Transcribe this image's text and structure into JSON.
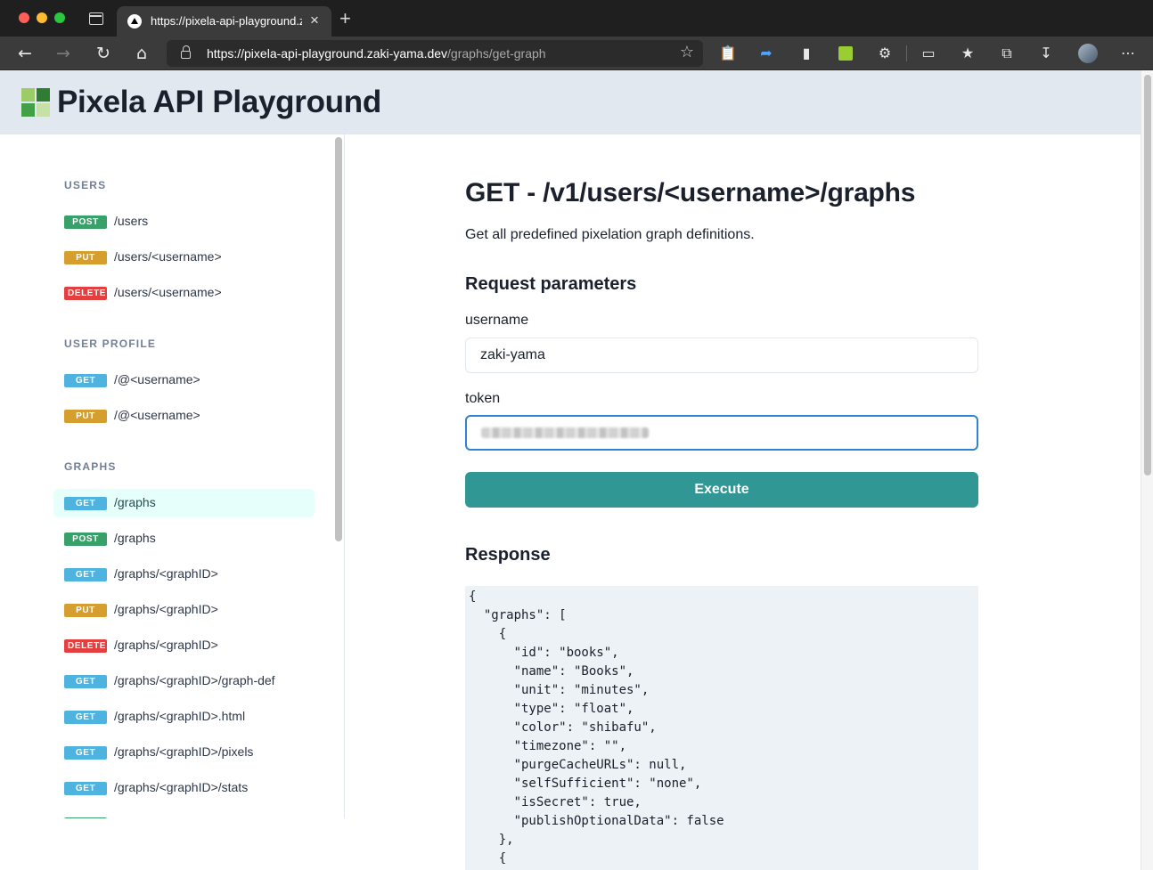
{
  "browser": {
    "tab_title": "https://pixela-api-playground.z",
    "tab_close": "×",
    "new_tab": "+",
    "url_host": "https://pixela-api-playground.zaki-yama.dev",
    "url_path": "/graphs/get-graph"
  },
  "icons": {
    "back": "back-arrow-icon",
    "forward": "forward-arrow-icon",
    "reload": "reload-icon",
    "home": "home-icon",
    "lock": "lock-icon",
    "favorite_add": "favorite-add-icon",
    "extensions": [
      "clipboard-icon",
      "share-icon",
      "bookmark-icon",
      "green-square-icon",
      "puzzle-icon"
    ],
    "cast": "cast-icon",
    "favorites": "favorites-icon",
    "collections": "collections-icon",
    "download": "download-icon",
    "more": "more-icon"
  },
  "header": {
    "title": "Pixela API Playground",
    "logo_colors": [
      "#9ccc65",
      "#2e7d32",
      "#43a047",
      "#c5e1a5"
    ]
  },
  "sidebar": {
    "groups": [
      {
        "title": "USERS",
        "items": [
          {
            "method": "POST",
            "path": "/users"
          },
          {
            "method": "PUT",
            "path": "/users/<username>"
          },
          {
            "method": "DELETE",
            "path": "/users/<username>"
          }
        ]
      },
      {
        "title": "USER PROFILE",
        "items": [
          {
            "method": "GET",
            "path": "/@<username>"
          },
          {
            "method": "PUT",
            "path": "/@<username>"
          }
        ]
      },
      {
        "title": "GRAPHS",
        "items": [
          {
            "method": "GET",
            "path": "/graphs",
            "active": true
          },
          {
            "method": "POST",
            "path": "/graphs"
          },
          {
            "method": "GET",
            "path": "/graphs/<graphID>"
          },
          {
            "method": "PUT",
            "path": "/graphs/<graphID>"
          },
          {
            "method": "DELETE",
            "path": "/graphs/<graphID>"
          },
          {
            "method": "GET",
            "path": "/graphs/<graphID>/graph-def"
          },
          {
            "method": "GET",
            "path": "/graphs/<graphID>.html"
          },
          {
            "method": "GET",
            "path": "/graphs/<graphID>/pixels"
          },
          {
            "method": "GET",
            "path": "/graphs/<graphID>/stats"
          }
        ]
      }
    ]
  },
  "main": {
    "title": "GET - /v1/users/<username>/graphs",
    "description": "Get all predefined pixelation graph definitions.",
    "params_title": "Request parameters",
    "username_label": "username",
    "username_value": "zaki-yama",
    "token_label": "token",
    "execute_label": "Execute",
    "response_title": "Response",
    "response_body": "{\n  \"graphs\": [\n    {\n      \"id\": \"books\",\n      \"name\": \"Books\",\n      \"unit\": \"minutes\",\n      \"type\": \"float\",\n      \"color\": \"shibafu\",\n      \"timezone\": \"\",\n      \"purgeCacheURLs\": null,\n      \"selfSufficient\": \"none\",\n      \"isSecret\": true,\n      \"publishOptionalData\": false\n    },\n    {\n      \"id\": \"playground\","
  },
  "colors": {
    "accent": "#319795",
    "get": "#4fb3e0",
    "post": "#38a169",
    "put": "#d69e2e",
    "delete": "#e53e3e"
  }
}
